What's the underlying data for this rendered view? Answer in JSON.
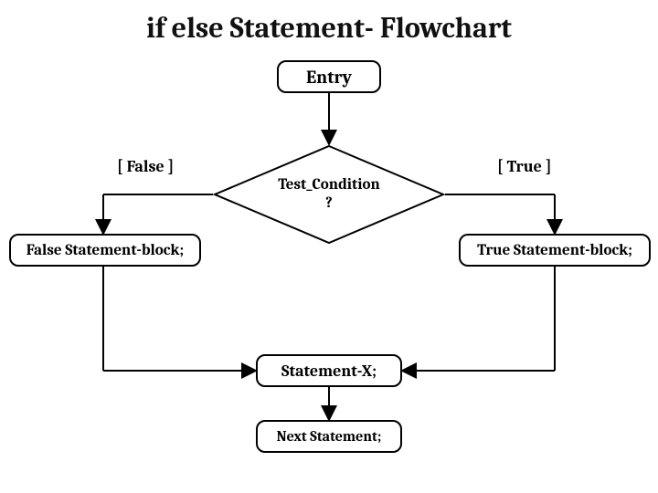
{
  "title": "if else Statement- Flowchart",
  "nodes": {
    "entry": "Entry",
    "condition_line1": "Test_Condition",
    "condition_line2": "?",
    "false_block": "False Statement-block;",
    "true_block": "True Statement-block;",
    "statement_x": "Statement-X;",
    "next_statement": "Next Statement;"
  },
  "labels": {
    "false": "[ False ]",
    "true": "[ True ]"
  }
}
